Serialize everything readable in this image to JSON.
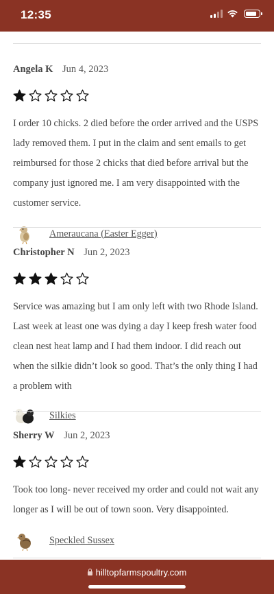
{
  "status": {
    "time": "12:35"
  },
  "reviews": [
    {
      "reviewer": "Angela K",
      "date": "Jun 4, 2023",
      "rating": 1,
      "body": "I order 10 chicks. 2 died before the order arrived and the USPS lady removed them. I put in the claim and sent emails to get reimbursed for those 2 chicks that died before arrival but the company just ignored me. I am very disappointed with the customer service.",
      "product": "Ameraucana (Easter Egger)"
    },
    {
      "reviewer": "Christopher N",
      "date": "Jun 2, 2023",
      "rating": 3,
      "body": "Service was amazing but I am only left with two Rhode Island. Last week at least one was dying a day I keep fresh water food clean nest heat lamp and I had them indoor. I did reach out when the silkie didn’t look so good. That’s the only thing I had a problem with",
      "product": "Silkies"
    },
    {
      "reviewer": "Sherry W",
      "date": "Jun 2, 2023",
      "rating": 1,
      "body": "Took too long- never received my order and could not wait any longer as I will be out of town soon. Very disappointed.",
      "product": "Speckled Sussex"
    }
  ],
  "browser": {
    "url": "hilltopfarmspoultry.com"
  },
  "colors": {
    "brand": "#8a3324",
    "star": "#111111"
  }
}
